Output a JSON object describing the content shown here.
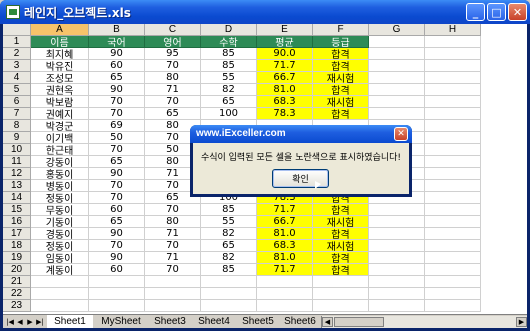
{
  "window": {
    "title": "레인지_오브젝트.xls",
    "minimize": "_",
    "maximize": "□",
    "close": "✕"
  },
  "columns": [
    "A",
    "B",
    "C",
    "D",
    "E",
    "F",
    "G",
    "H"
  ],
  "header_row": [
    "이름",
    "국어",
    "영어",
    "수학",
    "평균",
    "등급"
  ],
  "rows": [
    [
      "최지혜",
      "90",
      "95",
      "85",
      "90.0",
      "합격"
    ],
    [
      "박유진",
      "60",
      "70",
      "85",
      "71.7",
      "합격"
    ],
    [
      "조성모",
      "65",
      "80",
      "55",
      "66.7",
      "재시험"
    ],
    [
      "권현옥",
      "90",
      "71",
      "82",
      "81.0",
      "합격"
    ],
    [
      "박보람",
      "70",
      "70",
      "65",
      "68.3",
      "재시험"
    ],
    [
      "권예지",
      "70",
      "65",
      "100",
      "78.3",
      "합격"
    ],
    [
      "박경군",
      "69",
      "80",
      "",
      "",
      ""
    ],
    [
      "이기백",
      "50",
      "70",
      "",
      "",
      ""
    ],
    [
      "한근태",
      "70",
      "50",
      "",
      "",
      ""
    ],
    [
      "강동이",
      "65",
      "80",
      "",
      "",
      ""
    ],
    [
      "홍동이",
      "90",
      "71",
      "",
      "",
      ""
    ],
    [
      "병동이",
      "70",
      "70",
      "",
      "",
      ""
    ],
    [
      "정동이",
      "70",
      "65",
      "100",
      "78.3",
      "합격"
    ],
    [
      "무동이",
      "60",
      "70",
      "85",
      "71.7",
      "합격"
    ],
    [
      "기동이",
      "65",
      "80",
      "55",
      "66.7",
      "재시험"
    ],
    [
      "경동이",
      "90",
      "71",
      "82",
      "81.0",
      "합격"
    ],
    [
      "정동이",
      "70",
      "70",
      "65",
      "68.3",
      "재시험"
    ],
    [
      "임동이",
      "90",
      "71",
      "82",
      "81.0",
      "합격"
    ],
    [
      "계동이",
      "60",
      "70",
      "85",
      "71.7",
      "합격"
    ]
  ],
  "row_numbers": [
    "1",
    "2",
    "3",
    "4",
    "5",
    "6",
    "7",
    "8",
    "9",
    "10",
    "11",
    "12",
    "13",
    "14",
    "15",
    "16",
    "17",
    "18",
    "19",
    "20",
    "21",
    "22",
    "23"
  ],
  "sheet_tabs": [
    "Sheet1",
    "MySheet",
    "Sheet3",
    "Sheet4",
    "Sheet5",
    "Sheet6"
  ],
  "dialog": {
    "title": "www.iExceller.com",
    "message": "수식이 입력된 모든 셀을 노란색으로 표시하였습니다!",
    "ok": "확인",
    "close": "✕"
  },
  "colors": {
    "header_green": "#2e8b57",
    "highlight_yellow": "#ffff00",
    "titlebar_blue": "#0a4ad0"
  }
}
